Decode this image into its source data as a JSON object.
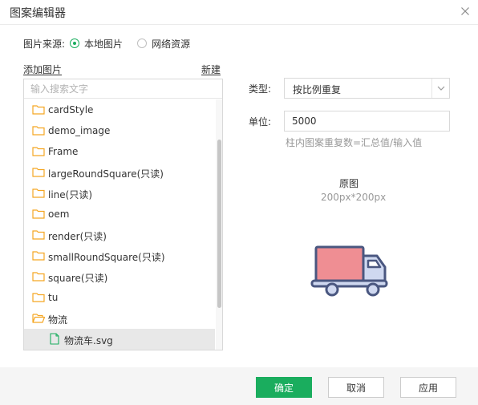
{
  "dialog": {
    "title": "图案编辑器"
  },
  "source": {
    "label": "图片来源:",
    "options": [
      {
        "label": "本地图片",
        "checked": true
      },
      {
        "label": "网络资源",
        "checked": false
      }
    ]
  },
  "left_panel": {
    "add_label": "添加图片",
    "new_label": "新建",
    "search_placeholder": "输入搜索文字",
    "items": [
      {
        "label": "cardStyle",
        "icon": "folder-icon"
      },
      {
        "label": "demo_image",
        "icon": "folder-icon"
      },
      {
        "label": "Frame",
        "icon": "folder-icon"
      },
      {
        "label": "largeRoundSquare(只读)",
        "icon": "folder-icon"
      },
      {
        "label": "line(只读)",
        "icon": "folder-icon"
      },
      {
        "label": "oem",
        "icon": "folder-icon"
      },
      {
        "label": "render(只读)",
        "icon": "folder-icon"
      },
      {
        "label": "smallRoundSquare(只读)",
        "icon": "folder-icon"
      },
      {
        "label": "square(只读)",
        "icon": "folder-icon"
      },
      {
        "label": "tu",
        "icon": "folder-icon"
      },
      {
        "label": "物流",
        "icon": "folder-open-icon"
      },
      {
        "label": "物流车.svg",
        "icon": "svg-file-icon",
        "selected": true
      }
    ]
  },
  "settings": {
    "type_label": "类型:",
    "type_value": "按比例重复",
    "unit_label": "单位:",
    "unit_value": "5000",
    "hint": "柱内图案重复数=汇总值/输入值"
  },
  "preview": {
    "title": "原图",
    "size": "200px*200px",
    "image_icon": "truck-icon"
  },
  "buttons": {
    "ok": "确定",
    "cancel": "取消",
    "apply": "应用"
  },
  "colors": {
    "accent": "#1aad5e",
    "folder": "#f5a623",
    "truck_body": "#ef8e93",
    "truck_outline": "#4a5780",
    "truck_cab": "#cfd8f0"
  }
}
